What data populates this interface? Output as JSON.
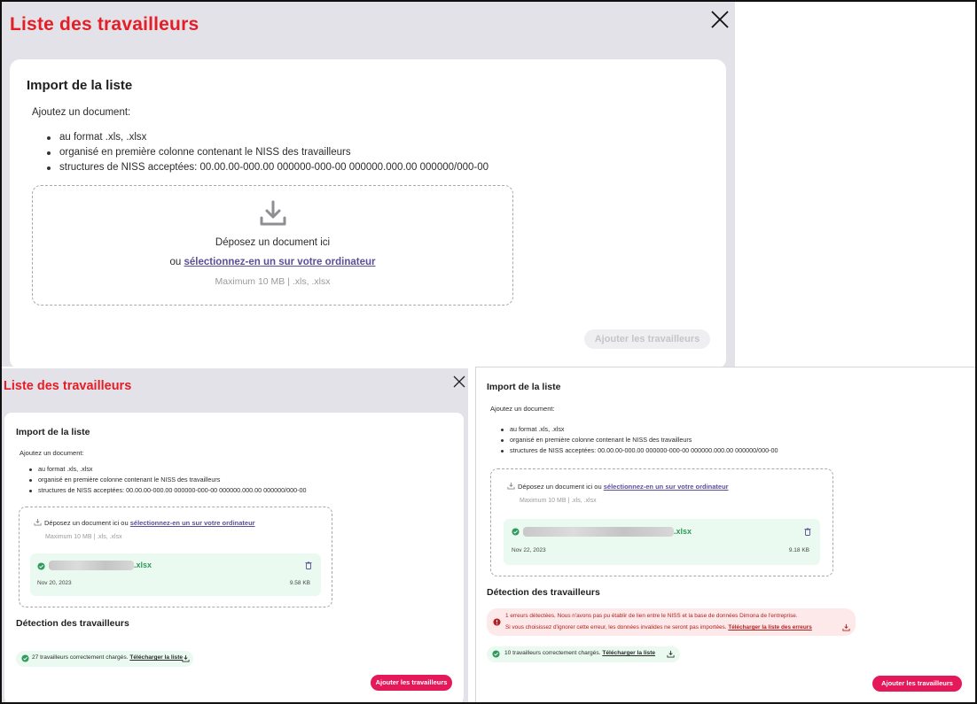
{
  "colors": {
    "title_red": "#e41e26",
    "link_purple": "#5b4f9a",
    "success_green": "#2f9a5a",
    "success_bg": "#eafaf0",
    "error_red": "#b2211f",
    "error_bg": "#fde9e9",
    "button_pink": "#e5185a",
    "overlay_gray": "#e3e2e8"
  },
  "icons": {
    "close": "close-icon",
    "download": "download-icon",
    "check": "check-circle-icon",
    "trash": "trash-icon",
    "error": "error-circle-icon"
  },
  "shared": {
    "window_title": "Liste des travailleurs",
    "import_heading": "Import de la liste",
    "intro": "Ajoutez un document:",
    "requirements": [
      "au format .xls, .xlsx",
      "organisé en première colonne contenant le NISS des travailleurs",
      "structures de NISS acceptées: 00.00.00-000.00 000000-000-00 000000.000.00 000000/000-00"
    ],
    "drop_text": "Déposez un document ici",
    "or_text": "ou",
    "select_link": "sélectionnez-en un sur votre ordinateur",
    "drop_inline_prefix": "Déposez un document ici ou",
    "max_text": "Maximum 10 MB | .xls, .xlsx",
    "detection_heading": "Détection des travailleurs",
    "add_button": "Ajouter les travailleurs",
    "file_ext": ".xlsx"
  },
  "panelB": {
    "file_date": "Nov 20, 2023",
    "file_size": "9.58 KB",
    "success_text": "27 travailleurs correctement chargés.",
    "download_list": "Télécharger la liste"
  },
  "panelC": {
    "file_date": "Nov 22, 2023",
    "file_size": "9.18 KB",
    "error_line1": "1 erreurs détectées. Nous n'avons pas pu établir de lien entre le NISS et la base de données Dimona de l'entreprise.",
    "error_line2": "Si vous choisissez d'ignorer cette erreur, les données invalides ne seront pas importées.",
    "download_errors": "Télécharger la liste des erreurs",
    "success_text": "10 travailleurs correctement chargés.",
    "download_list": "Télécharger la liste"
  }
}
